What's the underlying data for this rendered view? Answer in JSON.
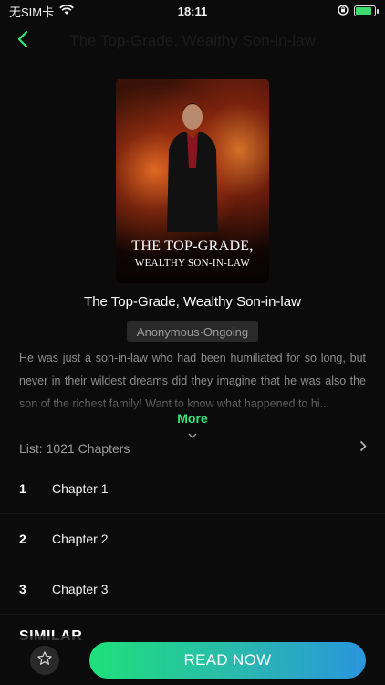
{
  "status_bar": {
    "carrier": "无SIM卡",
    "time": "18:11",
    "battery_level": 0.85,
    "battery_color": "#3ddc6a"
  },
  "nav": {
    "back_icon": "chevron-left-icon",
    "title": "The Top-Grade, Wealthy Son-in-law",
    "accent_color": "#2ee878"
  },
  "cover": {
    "line1": "THE TOP-GRADE,",
    "line2": "WEALTHY SON-IN-LAW"
  },
  "book": {
    "title": "The Top-Grade, Wealthy Son-in-law",
    "tag": "Anonymous·Ongoing",
    "description": "He was just a son-in-law who had been humiliated for so long, but never in their wildest dreams did they imagine that he was also the son of the richest family! Want to know what happened to hi...",
    "more_label": "More"
  },
  "chapters": {
    "header": "List: 1021 Chapters",
    "items": [
      {
        "num": "1",
        "title": "Chapter 1"
      },
      {
        "num": "2",
        "title": "Chapter 2"
      },
      {
        "num": "3",
        "title": "Chapter 3"
      }
    ]
  },
  "similar": {
    "label": "SIMILAR"
  },
  "bottom": {
    "fav_icon": "star-icon",
    "read_label": "READ NOW"
  }
}
